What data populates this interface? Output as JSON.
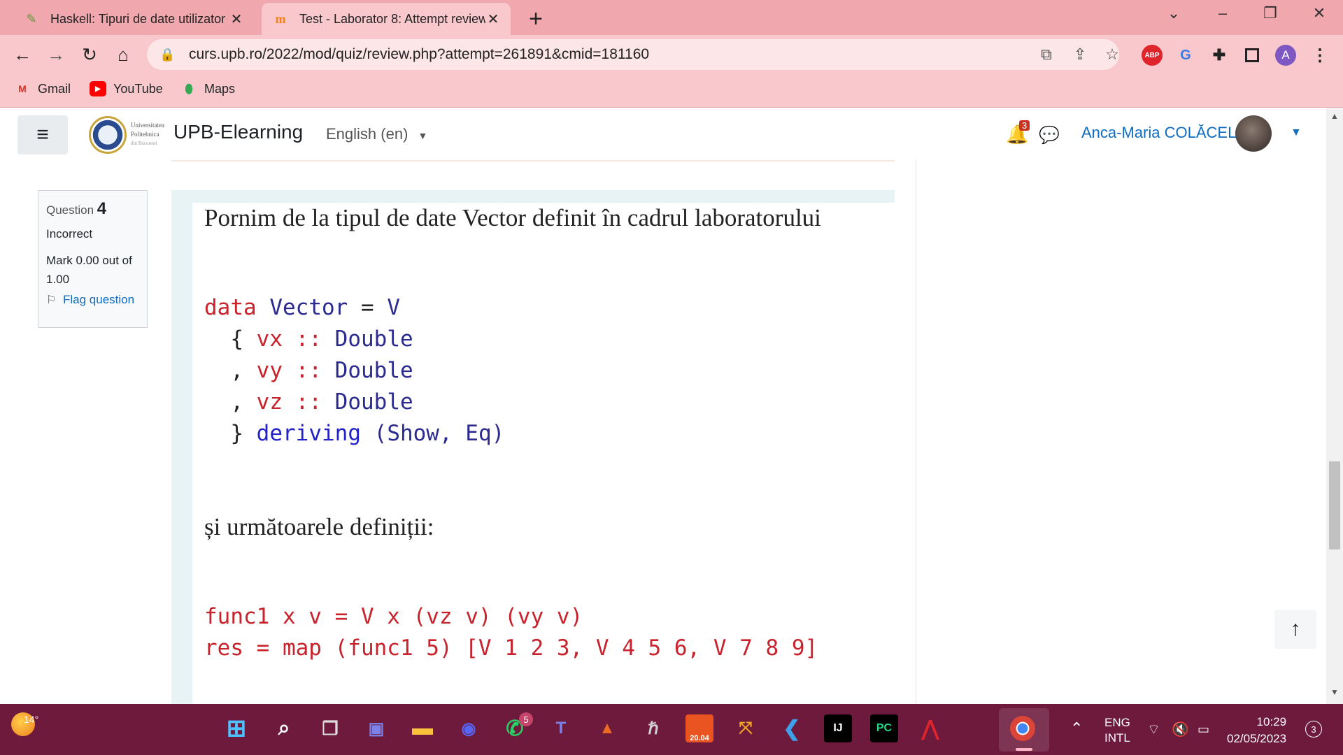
{
  "browser": {
    "tabs": [
      {
        "title": "Haskell: Tipuri de date utilizator |",
        "favicon": "haskell-icon",
        "active": false
      },
      {
        "title": "Test - Laborator 8: Attempt review",
        "favicon": "moodle-icon",
        "active": true
      }
    ],
    "address": "curs.upb.ro/2022/mod/quiz/review.php?attempt=261891&cmid=181160",
    "profile_initial": "A",
    "abp_label": "ABP",
    "bookmarks": [
      {
        "label": "Gmail",
        "icon": "gmail-icon"
      },
      {
        "label": "YouTube",
        "icon": "youtube-icon"
      },
      {
        "label": "Maps",
        "icon": "maps-icon"
      }
    ]
  },
  "moodle": {
    "logo_text": [
      "Universitatea",
      "Politehnica",
      "din Bucuresti"
    ],
    "site_name": "UPB-Elearning",
    "language": "English (en)",
    "notification_count": "3",
    "user_name": "Anca-Maria COLĂCEL"
  },
  "question": {
    "label": "Question",
    "number": "4",
    "state": "Incorrect",
    "grade": "Mark 0.00 out of 1.00",
    "flag": "Flag question",
    "intro": "Pornim de la tipul de date Vector definit în cadrul laboratorului",
    "code1": {
      "line1": {
        "kw": "data",
        "type": "Vector",
        "eq": "=",
        "con": "V"
      },
      "fields": [
        {
          "sep": "{",
          "name": "vx",
          "op": "::",
          "type": "Double"
        },
        {
          "sep": ",",
          "name": "vy",
          "op": "::",
          "type": "Double"
        },
        {
          "sep": ",",
          "name": "vz",
          "op": "::",
          "type": "Double"
        }
      ],
      "deriving": {
        "close": "}",
        "kw": "deriving",
        "classes": "(Show, Eq)"
      }
    },
    "mid_text": "și următoarele definiții:",
    "code2": {
      "line1": "func1 x v = V x (vz v) (vy v)",
      "line2": "res = map (func1 5) [V 1 2 3, V 4 5 6, V 7 8 9]"
    }
  },
  "taskbar": {
    "temperature": "14°",
    "whatsapp_badge": "5",
    "ubuntu_label": "20.04",
    "lang_line1": "ENG",
    "lang_line2": "INTL",
    "time": "10:29",
    "date": "02/05/2023",
    "notifications": "3"
  }
}
